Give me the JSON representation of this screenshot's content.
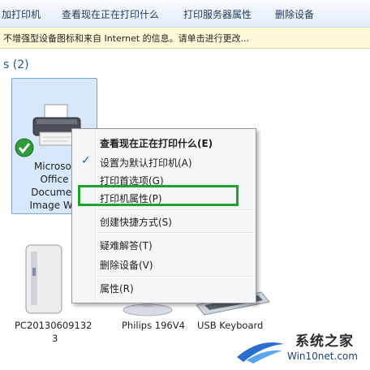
{
  "toolbar": {
    "add_printer": "加打印机",
    "see_printing": "查看现在正在打印什么",
    "print_server_props": "打印服务器属性",
    "remove_device": "删除设备"
  },
  "infobar": {
    "text": "不增强型设备图标和来自 Internet 的信息。请单击进行更改..."
  },
  "group": {
    "count_label": "s (2)"
  },
  "printer": {
    "label_lines": [
      "Microsof",
      "Office",
      "Documen",
      "Image Wri"
    ],
    "status_icon": "green-check-icon"
  },
  "devices": [
    {
      "label_line1": "PC20130609132",
      "label_line2": "3",
      "icon": "computer-tower-icon"
    },
    {
      "label": "Philips 196V4",
      "icon": "monitor-icon"
    },
    {
      "label": "USB Keyboard",
      "icon": "keyboard-icon"
    }
  ],
  "context_menu": {
    "items": [
      {
        "label": "查看现在正在打印什么(E)",
        "bold": true
      },
      {
        "label": "设置为默认打印机(A)",
        "checked": true
      },
      {
        "label": "打印首选项(G)"
      },
      {
        "label": "打印机属性(P)",
        "highlighted": true
      },
      {
        "label": "创建快捷方式(S)"
      },
      {
        "label": "疑难解答(T)"
      },
      {
        "label": "删除设备(V)"
      },
      {
        "label": "属性(R)"
      }
    ]
  },
  "watermark": {
    "brand": "系统之家",
    "url": "Win10net.com"
  },
  "colors": {
    "highlight": "#1fa12e",
    "selection": "#d8e8fb",
    "check": "#2b5fae"
  }
}
